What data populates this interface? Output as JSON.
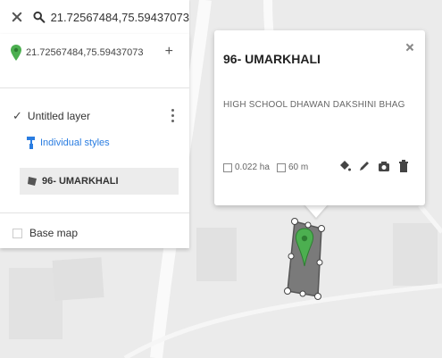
{
  "search": {
    "value": "21.72567484,75.59437073"
  },
  "panel": {
    "coordinate_text": "21.72567484,75.59437073",
    "add_symbol": "+",
    "layer": {
      "check_symbol": "✓",
      "name": "Untitled layer",
      "styles_label": "Individual styles",
      "feature_label": "96- UMARKHALI"
    },
    "basemap_label": "Base map"
  },
  "popup": {
    "title": "96- UMARKHALI",
    "description": "HIGH SCHOOL DHAWAN DAKSHINI BHAG",
    "area": "0.022 ha",
    "perimeter": "60 m"
  },
  "icons": {
    "close": "close-icon",
    "search": "search-icon",
    "pin": "map-pin-icon",
    "more": "more-vert-icon",
    "paint": "paint-roller-icon",
    "polygon": "polygon-icon",
    "style": "paint-bucket-icon",
    "edit": "pencil-icon",
    "camera": "camera-icon",
    "delete": "trash-icon"
  },
  "colors": {
    "pin_green": "#4caf50",
    "link_blue": "#2a7de1",
    "polygon_fill": "#7a7a7a"
  }
}
